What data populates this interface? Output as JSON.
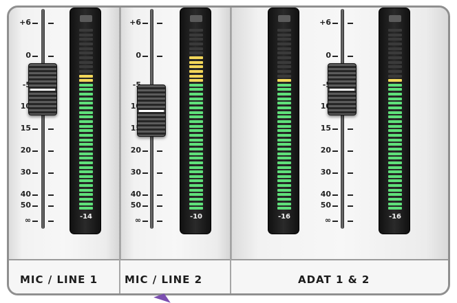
{
  "scale_marks": [
    "+6",
    "0",
    "-5",
    "10",
    "15",
    "20",
    "30",
    "40",
    "50",
    "∞"
  ],
  "channels": [
    {
      "name": "MIC / LINE 1",
      "meter_value": "-14",
      "fader_level_db": -6,
      "lit_yellow": 2,
      "lit_green": 28
    },
    {
      "name": "MIC / LINE 2",
      "meter_value": "-10",
      "fader_level_db": -11,
      "lit_yellow": 6,
      "lit_green": 28
    },
    {
      "name": "ADAT 1 & 2",
      "meter_value": "-16",
      "fader_level_db": null,
      "lit_yellow": 1,
      "lit_green": 28
    },
    {
      "name": "ADAT 1 & 2",
      "meter_value": "-16",
      "fader_level_db": -6,
      "lit_yellow": 1,
      "lit_green": 28
    }
  ],
  "group_labels": {
    "ch1": "MIC / LINE 1",
    "ch2": "MIC / LINE 2",
    "adat": "ADAT 1 & 2"
  },
  "colors": {
    "meter_green": "#5fe07a",
    "meter_yellow": "#f3d75a",
    "meter_off": "#3a3a3a",
    "pointer": "#7b4fb0"
  }
}
